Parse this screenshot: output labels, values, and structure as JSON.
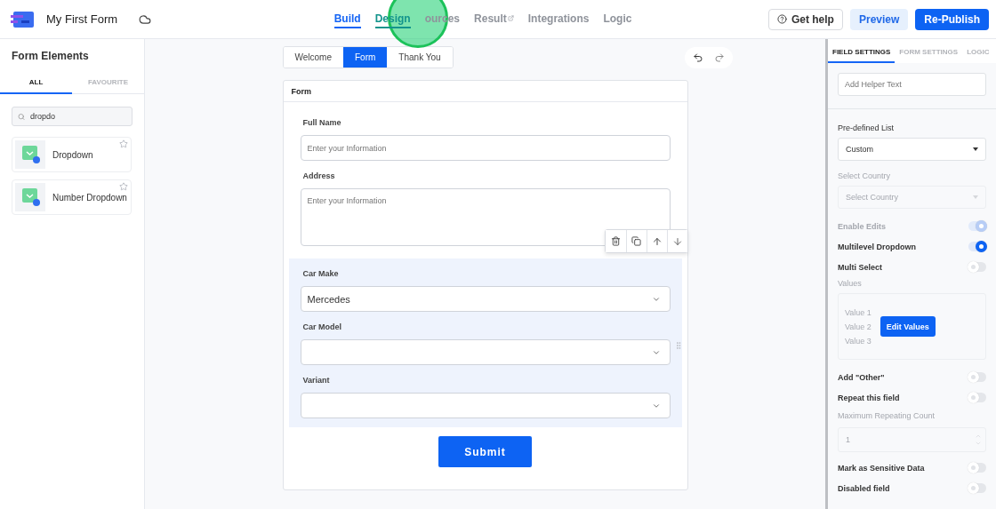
{
  "header": {
    "title": "My First Form",
    "nav": [
      {
        "label": "Build",
        "selected": true,
        "highlighted": false,
        "external": false
      },
      {
        "label": "Design",
        "selected": false,
        "highlighted": true,
        "external": false
      },
      {
        "label": "ources",
        "selected": false,
        "highlighted": false,
        "external": false
      },
      {
        "label": "Result",
        "selected": false,
        "highlighted": false,
        "external": true
      },
      {
        "label": "Integrations",
        "selected": false,
        "highlighted": false,
        "external": false
      },
      {
        "label": "Logic",
        "selected": false,
        "highlighted": false,
        "external": false
      }
    ],
    "help": "Get help",
    "preview": "Preview",
    "publish": "Re-Publish"
  },
  "sidebar": {
    "title": "Form Elements",
    "tabs": [
      {
        "label": "ALL",
        "selected": true
      },
      {
        "label": "FAVOURITE",
        "selected": false
      }
    ],
    "search": {
      "value": "dropdo"
    },
    "items": [
      {
        "label": "Dropdown",
        "starred": false
      },
      {
        "label": "Number Dropdown",
        "starred": false
      }
    ]
  },
  "canvas": {
    "pages": [
      {
        "label": "Welcome",
        "selected": false
      },
      {
        "label": "Form",
        "selected": true
      },
      {
        "label": "Thank You",
        "selected": false
      }
    ],
    "form": {
      "title": "Form",
      "fields": [
        {
          "kind": "text",
          "label": "Full Name",
          "placeholder": "Enter your Information",
          "grouped": false
        },
        {
          "kind": "textarea",
          "label": "Address",
          "placeholder": "Enter your Information",
          "grouped": false
        },
        {
          "kind": "select",
          "label": "Car Make",
          "value": "Mercedes",
          "grouped": true
        },
        {
          "kind": "select",
          "label": "Car Model",
          "grouped": true
        },
        {
          "kind": "select",
          "label": "Variant",
          "grouped": true
        }
      ],
      "submit": "Submit"
    }
  },
  "settings": {
    "tabs": [
      {
        "label": "FIELD SETTINGS",
        "selected": true
      },
      {
        "label": "FORM SETTINGS",
        "selected": false
      },
      {
        "label": "LOGIC",
        "selected": false
      }
    ],
    "items": [
      {
        "kind": "input",
        "placeholder": "Add Helper Text"
      },
      {
        "kind": "select",
        "label": "Pre-defined List",
        "value": "Custom",
        "disabled": false
      },
      {
        "kind": "select",
        "label": "Select Country",
        "placeholder": "Select Country",
        "disabled": true
      },
      {
        "kind": "toggle",
        "label": "Enable Edits",
        "on": true,
        "disabled": true
      },
      {
        "kind": "toggle",
        "label": "Multilevel Dropdown",
        "on": true,
        "disabled": false
      },
      {
        "kind": "toggle",
        "label": "Multi Select",
        "on": false,
        "disabled": false
      },
      {
        "kind": "values",
        "label": "Values",
        "values": [
          "Value 1",
          "Value 2",
          "Value 3"
        ],
        "button": "Edit Values",
        "disabled": true
      },
      {
        "kind": "toggle",
        "label": "Add \"Other\"",
        "on": false,
        "disabled": false
      },
      {
        "kind": "toggle",
        "label": "Repeat this field",
        "on": false,
        "disabled": false
      },
      {
        "kind": "number",
        "label": "Maximum Repeating Count",
        "value": "1",
        "disabled": true
      },
      {
        "kind": "toggle",
        "label": "Mark as Sensitive Data",
        "on": false,
        "disabled": false
      },
      {
        "kind": "toggle",
        "label": "Disabled field",
        "on": false,
        "disabled": false
      }
    ]
  }
}
